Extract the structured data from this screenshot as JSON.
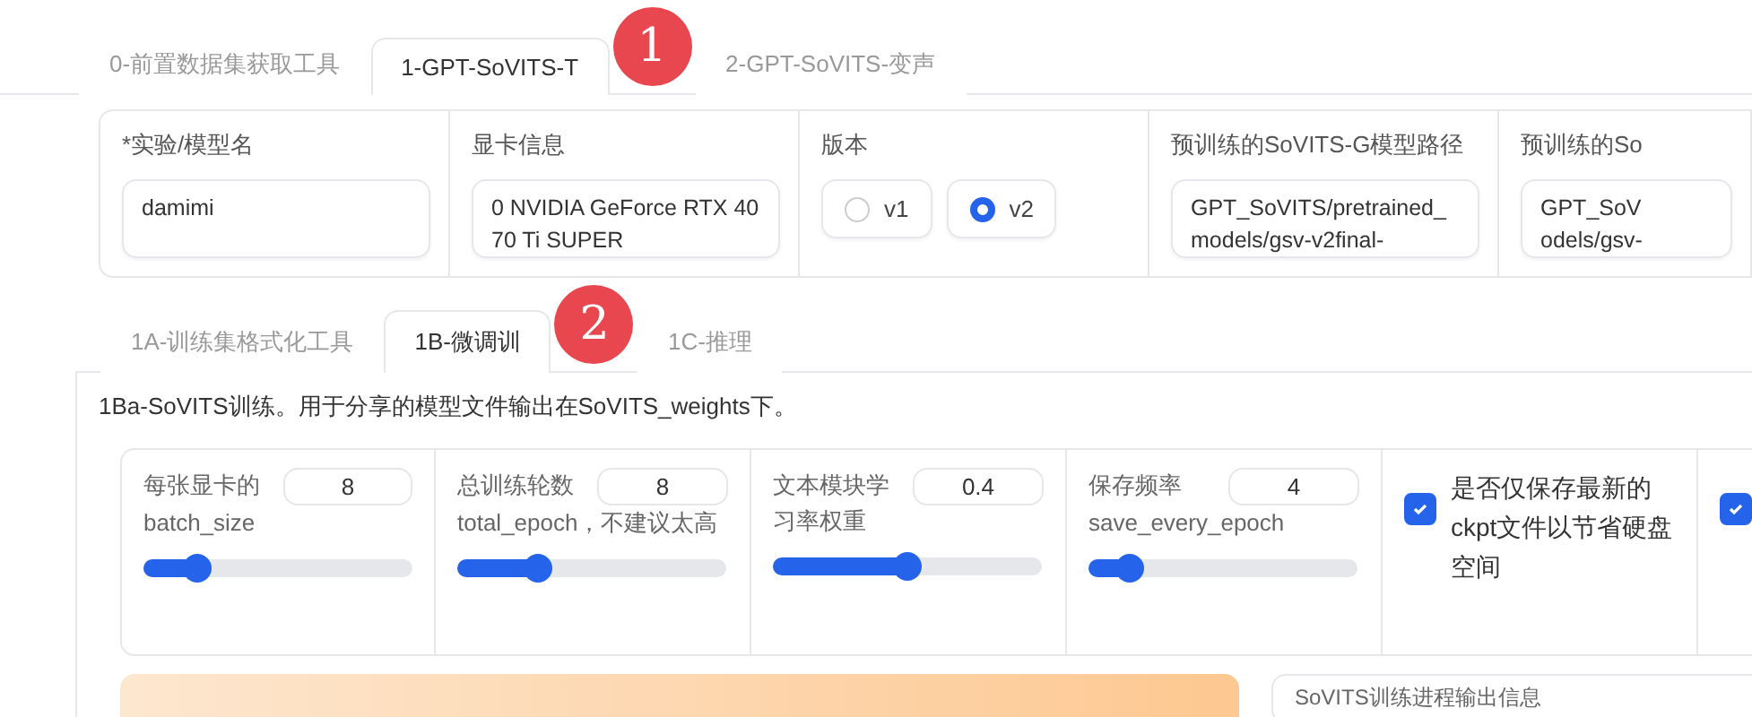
{
  "main_tabs": [
    {
      "label": "0-前置数据集获取工具",
      "selected": false
    },
    {
      "label": "1-GPT-SoVITS-T",
      "selected": true,
      "badge": "1"
    },
    {
      "label": "2-GPT-SoVITS-变声",
      "selected": false
    }
  ],
  "settings": [
    {
      "kind": "text",
      "label": "*实验/模型名",
      "value": "damimi"
    },
    {
      "kind": "text",
      "label": "显卡信息",
      "value": "0 NVIDIA GeForce RTX 4070 Ti SUPER"
    },
    {
      "kind": "radio",
      "label": "版本",
      "options": [
        {
          "label": "v1",
          "selected": false
        },
        {
          "label": "v2",
          "selected": true
        }
      ]
    },
    {
      "kind": "text",
      "label": "预训练的SoVITS-G模型路径",
      "value": "GPT_SoVITS/pretrained_models/gsv-v2final-"
    },
    {
      "kind": "text",
      "label": "预训练的So",
      "value": "GPT_SoV\nodels/gsv-"
    }
  ],
  "sub_tabs": [
    {
      "label": "1A-训练集格式化工具",
      "selected": false
    },
    {
      "label": "1B-微调训",
      "selected": true,
      "badge": "2"
    },
    {
      "label": "1C-推理",
      "selected": false
    }
  ],
  "description": "1Ba-SoVITS训练。用于分享的模型文件输出在SoVITS_weights下。",
  "params": [
    {
      "kind": "slider",
      "label": "每张显卡的",
      "sublabel": "batch_size",
      "value": "8",
      "level": 0.2
    },
    {
      "kind": "slider",
      "label": "总训练轮数",
      "sublabel": "total_epoch，不建议太高",
      "value": "8",
      "level": 0.3
    },
    {
      "kind": "slider",
      "label": "文本模块学习率权重",
      "value": "0.4",
      "level": 0.5
    },
    {
      "kind": "slider",
      "label": "保存频率",
      "sublabel": "save_every_epoch",
      "value": "4",
      "level": 0.15
    },
    {
      "kind": "checkbox",
      "label": "是否仅保存最新的ckpt文件以节省硬盘空间",
      "checked": true
    },
    {
      "kind": "checkbox",
      "checked": true
    }
  ],
  "output_box": {
    "label": "SoVITS训练进程输出信息"
  }
}
